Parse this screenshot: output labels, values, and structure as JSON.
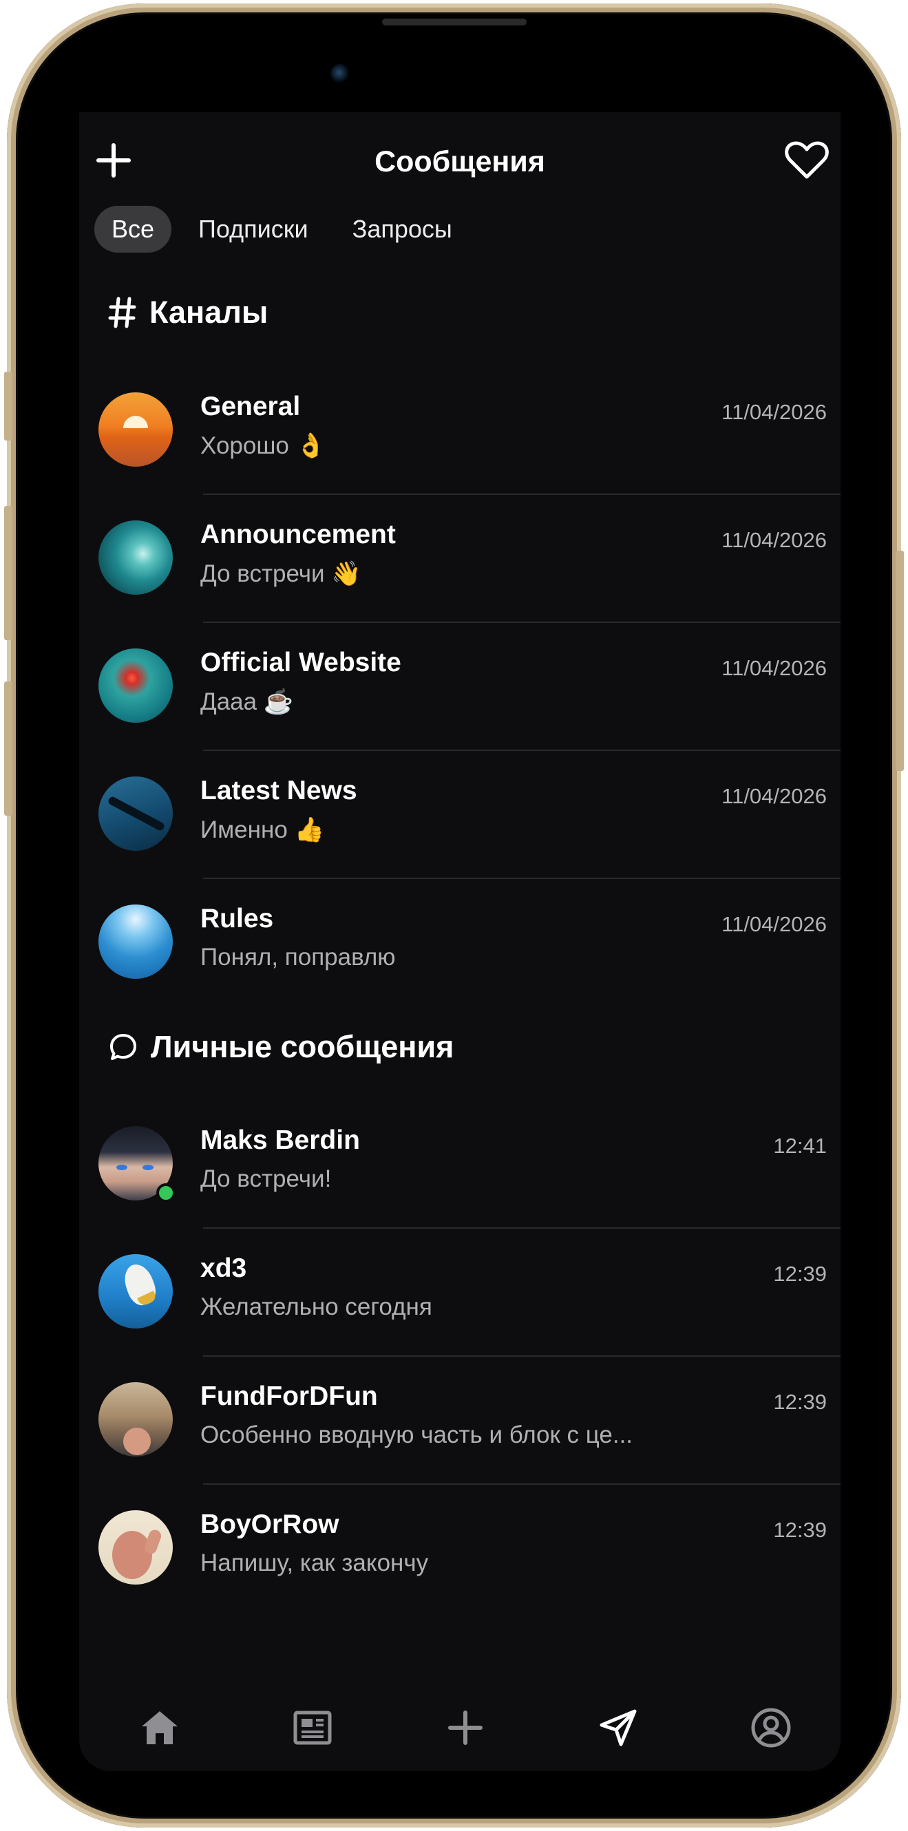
{
  "header": {
    "title": "Сообщения"
  },
  "tabs": [
    {
      "label": "Все",
      "active": true
    },
    {
      "label": "Подписки",
      "active": false
    },
    {
      "label": "Запросы",
      "active": false
    }
  ],
  "channels_section": {
    "label": "Каналы",
    "icon": "hash-icon"
  },
  "channels": [
    {
      "name": "General",
      "preview": "Хорошо 👌",
      "time": "11/04/2026"
    },
    {
      "name": "Announcement",
      "preview": "До встречи 👋",
      "time": "11/04/2026"
    },
    {
      "name": "Official Website",
      "preview": "Дааа ☕",
      "time": "11/04/2026"
    },
    {
      "name": "Latest News",
      "preview": "Именно 👍",
      "time": "11/04/2026"
    },
    {
      "name": "Rules",
      "preview": "Понял, поправлю",
      "time": "11/04/2026"
    }
  ],
  "dm_section": {
    "label": "Личные сообщения",
    "icon": "chat-bubble-icon"
  },
  "direct_messages": [
    {
      "name": "Maks Berdin",
      "preview": "До встречи!",
      "time": "12:41",
      "online": true
    },
    {
      "name": "xd3",
      "preview": "Желательно сегодня",
      "time": "12:39",
      "online": false
    },
    {
      "name": "FundForDFun",
      "preview": "Особенно вводную часть и блок с це...",
      "time": "12:39",
      "online": false
    },
    {
      "name": "BoyOrRow",
      "preview": "Напишу, как закончу",
      "time": "12:39",
      "online": false
    }
  ],
  "tabbar": [
    {
      "icon": "home-icon",
      "active": false
    },
    {
      "icon": "news-icon",
      "active": false
    },
    {
      "icon": "plus-icon",
      "active": false
    },
    {
      "icon": "paper-plane-icon",
      "active": true
    },
    {
      "icon": "profile-icon",
      "active": false
    }
  ],
  "colors": {
    "background": "#0d0d0f",
    "active_tab": "#3a3a3c",
    "online": "#34c759",
    "divider": "#2a2a2d"
  }
}
